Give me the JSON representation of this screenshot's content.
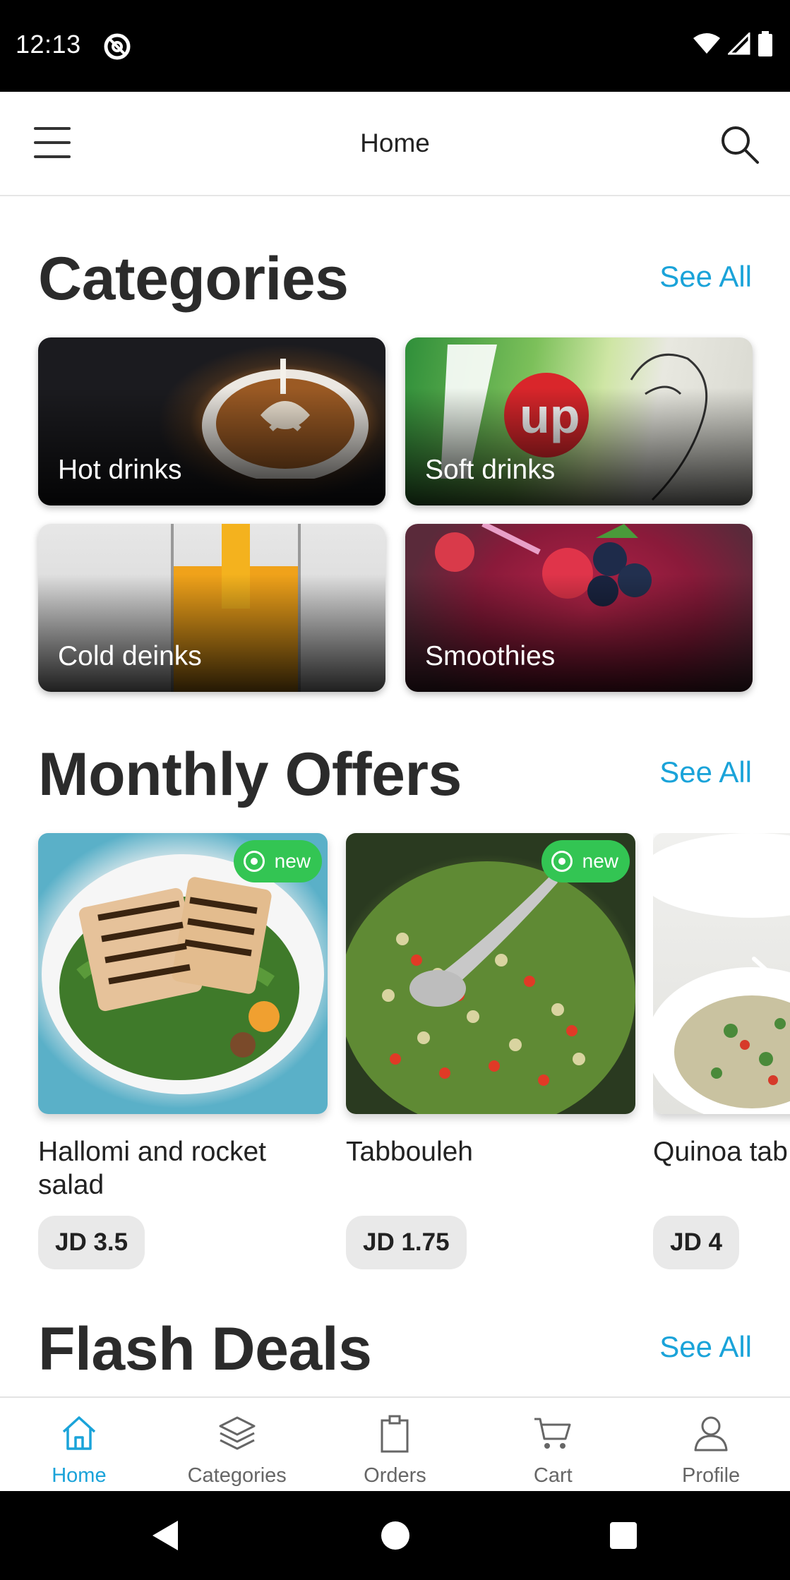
{
  "status_bar": {
    "time": "12:13"
  },
  "app_bar": {
    "title": "Home"
  },
  "categories_section": {
    "title": "Categories",
    "see_all": "See All",
    "items": [
      {
        "label": "Hot drinks"
      },
      {
        "label": "Soft drinks"
      },
      {
        "label": "Cold deinks"
      },
      {
        "label": "Smoothies"
      }
    ]
  },
  "offers_section": {
    "title": "Monthly Offers",
    "see_all": "See All",
    "items": [
      {
        "name": "Hallomi and rocket salad",
        "price": "JD 3.5",
        "badge": "new"
      },
      {
        "name": "Tabbouleh",
        "price": "JD 1.75",
        "badge": "new"
      },
      {
        "name": "Quinoa tab salad",
        "price": "JD 4",
        "badge": ""
      }
    ]
  },
  "flash_section": {
    "title": "Flash Deals",
    "see_all": "See All"
  },
  "bottom_nav": {
    "items": [
      {
        "label": "Home",
        "icon": "home-icon",
        "active": true
      },
      {
        "label": "Categories",
        "icon": "layers-icon",
        "active": false
      },
      {
        "label": "Orders",
        "icon": "clipboard-icon",
        "active": false
      },
      {
        "label": "Cart",
        "icon": "cart-icon",
        "active": false
      },
      {
        "label": "Profile",
        "icon": "user-icon",
        "active": false
      }
    ]
  },
  "colors": {
    "accent": "#1aa3d9",
    "badge_green": "#33c553",
    "heading": "#2b2b2b",
    "price_chip": "#e9e9e9"
  }
}
